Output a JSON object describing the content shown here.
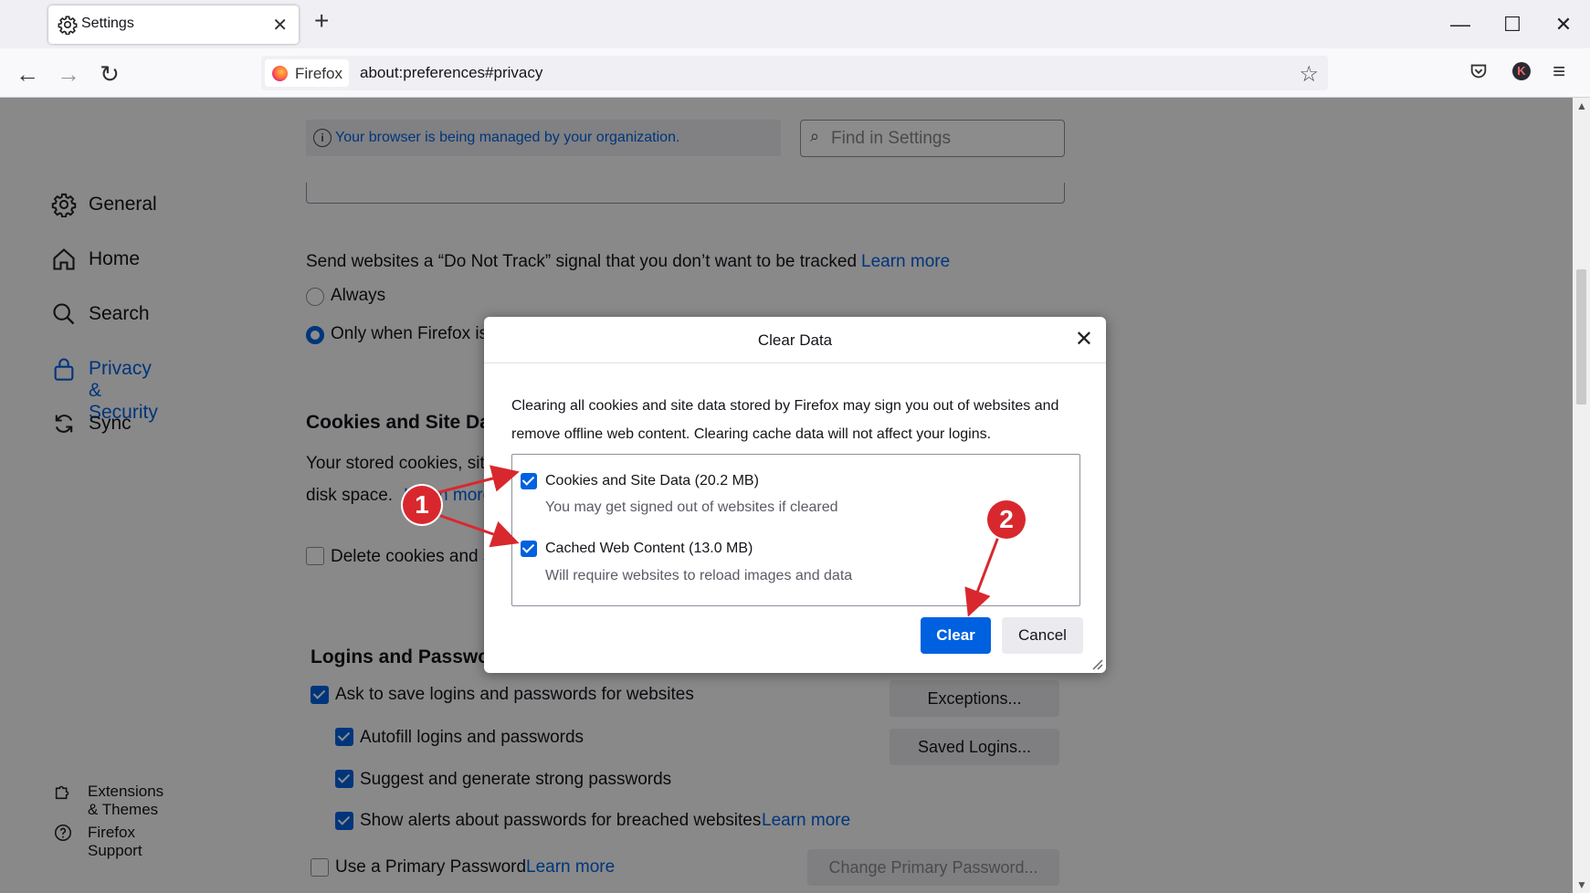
{
  "tab": {
    "title": "Settings",
    "close": "✕"
  },
  "new_tab": "+",
  "window": {
    "minimize": "—",
    "maximize": "☐",
    "close": "✕"
  },
  "nav": {
    "back": "←",
    "forward": "→",
    "reload": "↻",
    "identity_label": "Firefox",
    "url": "about:preferences#privacy",
    "bookmark": "☆",
    "avatar_letter": "K",
    "menu": "≡"
  },
  "sidebar": {
    "items": [
      {
        "label": "General",
        "icon": "gear-icon"
      },
      {
        "label": "Home",
        "icon": "home-icon"
      },
      {
        "label": "Search",
        "icon": "search-icon"
      },
      {
        "label": "Privacy & Security",
        "icon": "lock-icon"
      },
      {
        "label": "Sync",
        "icon": "sync-icon"
      }
    ],
    "footer": [
      {
        "label": "Extensions & Themes",
        "icon": "puzzle-icon"
      },
      {
        "label": "Firefox Support",
        "icon": "help-icon"
      }
    ]
  },
  "managed_notice": "Your browser is being managed by your organization.",
  "find_placeholder": "Find in Settings",
  "dnt": {
    "text": "Send websites a “Do Not Track” signal that you don’t want to be tracked",
    "learn_more": "Learn more",
    "always": "Always",
    "only_when": "Only when Firefox is"
  },
  "cookies": {
    "heading": "Cookies and Site Da",
    "desc1": "Your stored cookies, site",
    "desc2": "disk space.",
    "learn_more_partial": "Learn more",
    "delete_label": "Delete cookies and s"
  },
  "logins": {
    "heading": "Logins and Passwor",
    "ask_save": "Ask to save logins and passwords for websites",
    "autofill": "Autofill logins and passwords",
    "suggest": "Suggest and generate strong passwords",
    "alerts": "Show alerts about passwords for breached websites",
    "alerts_learn_more": "Learn more",
    "primary": "Use a Primary Password",
    "primary_learn_more": "Learn more",
    "exceptions_btn": "Exceptions...",
    "saved_logins_btn": "Saved Logins...",
    "change_primary_btn": "Change Primary Password..."
  },
  "dialog": {
    "title": "Clear Data",
    "close": "✕",
    "description": "Clearing all cookies and site data stored by Firefox may sign you out of websites and remove offline web content. Clearing cache data will not affect your logins.",
    "options": [
      {
        "label": "Cookies and Site Data (20.2 MB)",
        "sub": "You may get signed out of websites if cleared",
        "checked": true
      },
      {
        "label": "Cached Web Content (13.0 MB)",
        "sub": "Will require websites to reload images and data",
        "checked": true
      }
    ],
    "clear_button": "Clear",
    "cancel_button": "Cancel"
  },
  "annotations": {
    "badge1": "1",
    "badge2": "2",
    "color": "#d8282e"
  },
  "colors": {
    "accent": "#0061e0",
    "annotation": "#d8282e"
  }
}
